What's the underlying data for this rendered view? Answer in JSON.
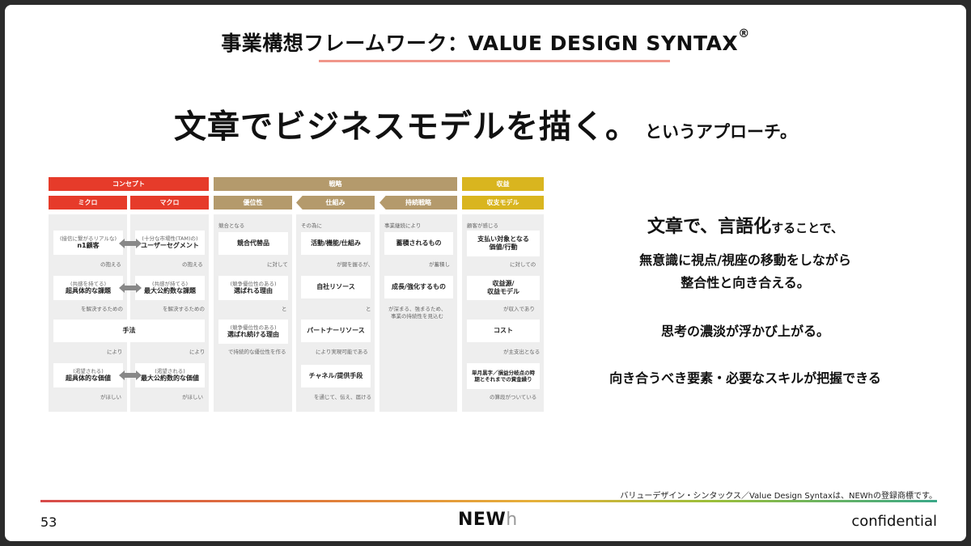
{
  "title": {
    "text": "事業構想フレームワーク：VALUE DESIGN SYNTAX",
    "mark": "®"
  },
  "headline": {
    "main": "文章でビジネスモデルを描く。",
    "sub": "というアプローチ。"
  },
  "framework": {
    "top": {
      "concept": "コンセプト",
      "strategy": "戦略",
      "revenue": "収益"
    },
    "sub": {
      "micro": "ミクロ",
      "macro": "マクロ",
      "advantage": "優位性",
      "mechanism": "仕組み",
      "sustain": "持続戦略",
      "model": "収支モデル"
    },
    "micro": {
      "n1_note": "(接信に繋がるリアルな)",
      "n1": "n1顧客",
      "after1": "の抱える",
      "issue_note": "(共感を持てる)",
      "issue": "超具体的な課題",
      "after2": "を解決するための",
      "method": "手法",
      "after3": "により",
      "value_note": "(渇望される)",
      "value": "超具体的な価値",
      "after4": "がほしい"
    },
    "macro": {
      "seg_note": "(十分な市場性(TAM)の)",
      "seg": "ユーザーセグメント",
      "after1": "の抱える",
      "issue_note": "(共感が持てる)",
      "issue": "最大公約数な課題",
      "after2": "を解決するための",
      "after3": "により",
      "value_note": "(渇望される)",
      "value": "最大公約数的な価値",
      "after4": "がほしい"
    },
    "advantage": {
      "lead": "競合となる",
      "alt": "競合代替品",
      "after1": "に対して",
      "r1_note": "(競争優位性のある)",
      "r1": "選ばれる理由",
      "after2": "と",
      "r2_note": "(競争優位性のある)",
      "r2": "選ばれ続ける理由",
      "after3": "で持続的な優位性を作る"
    },
    "mechanism": {
      "lead": "その為に",
      "b1": "活動/機能/仕組み",
      "after1": "が鍵を握るが、",
      "b2": "自社リソース",
      "after2": "と",
      "b3": "パートナーリソース",
      "after3": "により実現可能である",
      "b4": "チャネル/提供手段",
      "after4": "を通じて、伝え、届ける"
    },
    "sustain": {
      "lead": "事業継続により",
      "b1": "蓄積されるもの",
      "after1": "が蓄積し",
      "b2": "成長/強化するもの",
      "after2a": "が深まる、強まるため、",
      "after2b": "事業の持続性を見込む"
    },
    "model": {
      "lead": "顧客が感じる",
      "b1": "支払い対象となる\n価値/行動",
      "after1": "に対しての",
      "b2": "収益源/\n収益モデル",
      "after2": "が収入であり",
      "b3": "コスト",
      "after3": "が主支出となる",
      "b4": "単月黒字／損益分岐点の時期とそれまでの資金繰り",
      "after4": "の算段がついている"
    }
  },
  "right_text": {
    "line1_big": "文章で、言語化",
    "line1_small": "することで、",
    "line2": "無意識に視点/視座の移動をしながら",
    "line3": "整合性と向き合える。",
    "line4": "思考の濃淡が浮かび上がる。",
    "line5": "向き合うべき要素・必要なスキルが把握できる"
  },
  "footer": {
    "note": "バリューデザイン・シンタックス／Value Design Syntaxは、NEWhの登録商標です。",
    "page": "53",
    "logo_main": "NEW",
    "logo_h": "h",
    "confidential": "confidential"
  },
  "colors": {
    "red": "#e63b2a",
    "tan": "#b49a6c",
    "gold": "#d9b51f",
    "accent_line": "#f0968a"
  }
}
